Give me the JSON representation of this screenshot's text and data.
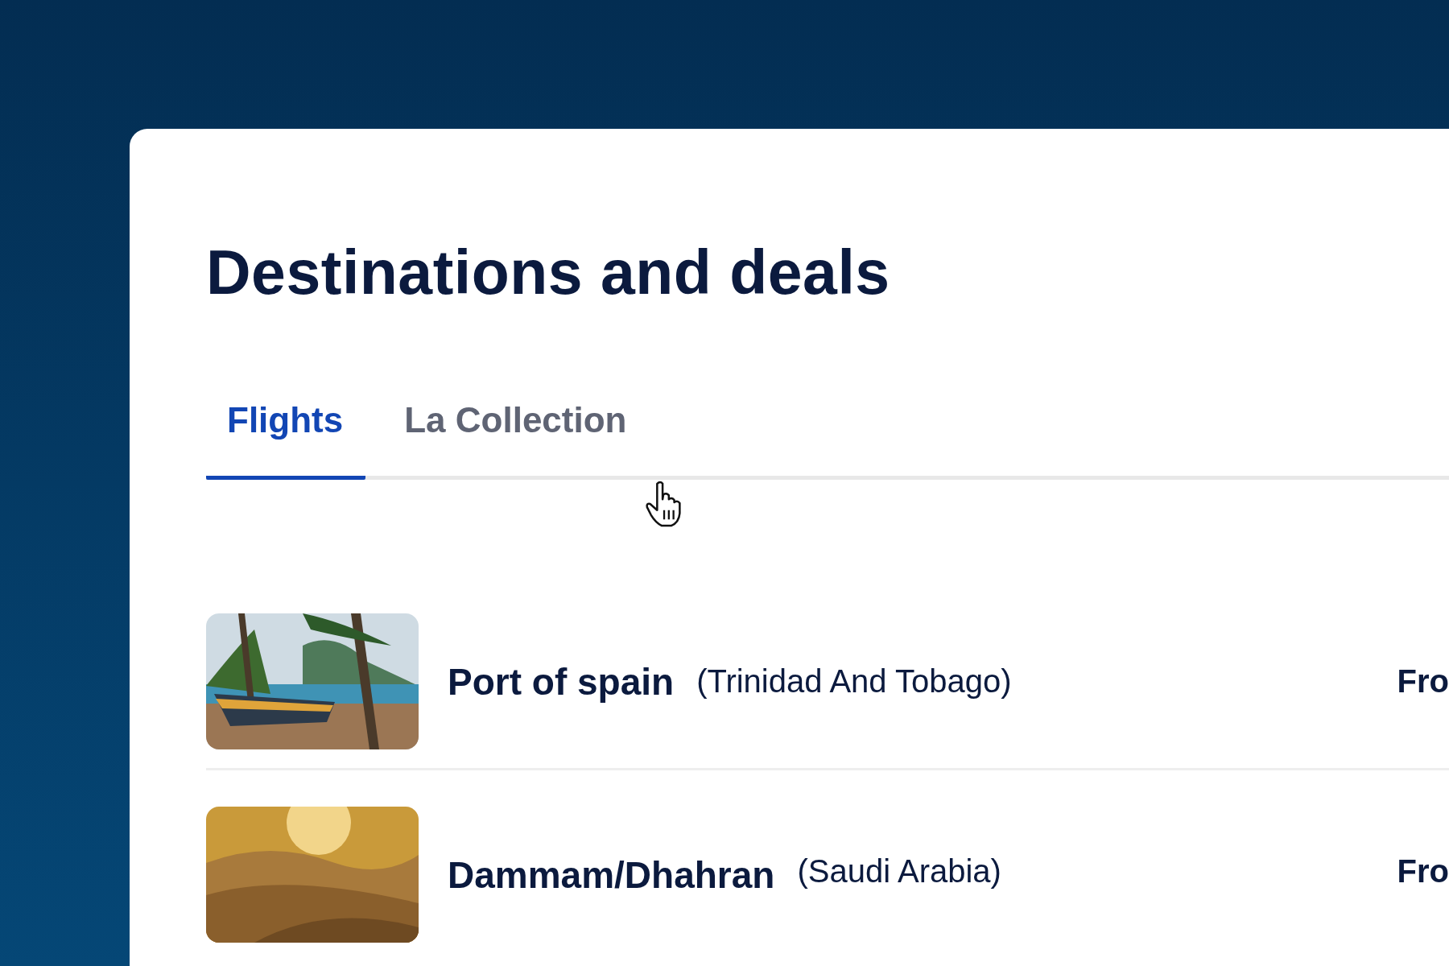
{
  "title": "Destinations and deals",
  "tabs": [
    {
      "label": "Flights",
      "selected": true
    },
    {
      "label": "La Collection",
      "selected": false
    }
  ],
  "destinations": [
    {
      "city": "Port of spain",
      "country": "(Trinidad And Tobago)",
      "price_label": "Fro",
      "kind": "picture"
    },
    {
      "city": "Dammam/Dhahran",
      "country": "(Saudi Arabia)",
      "price_label": "Fro",
      "kind": "picture"
    }
  ]
}
